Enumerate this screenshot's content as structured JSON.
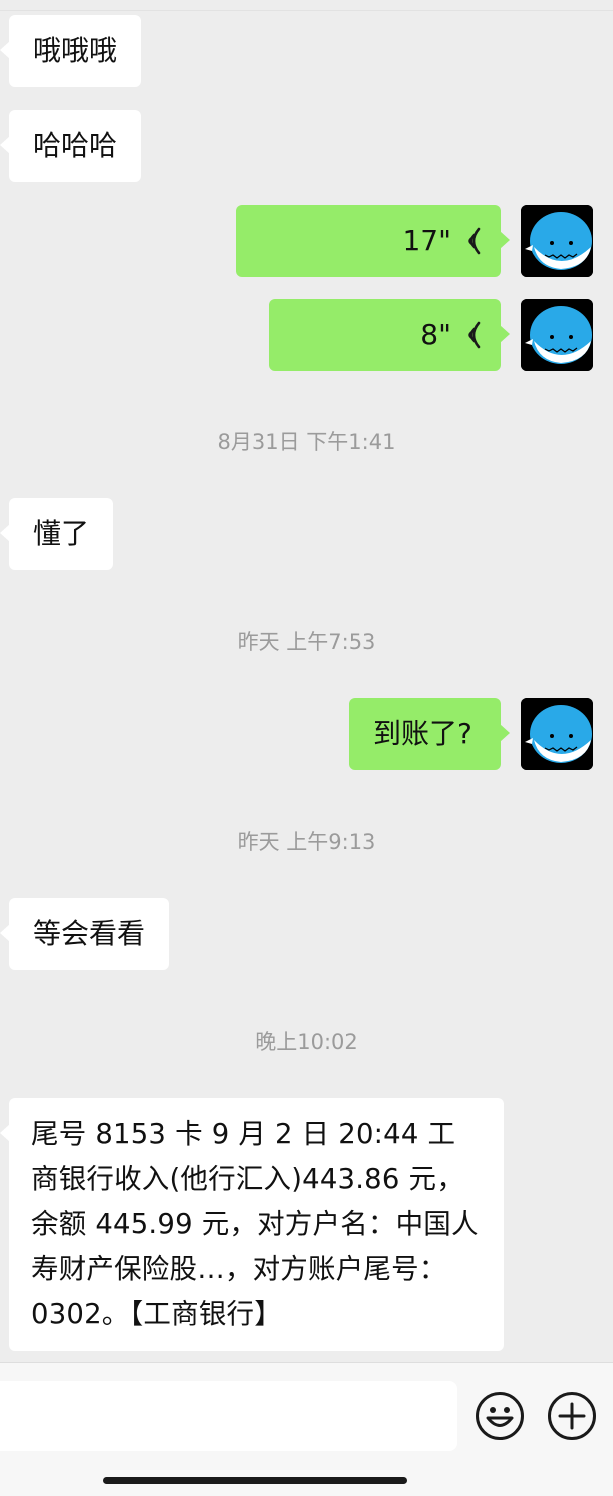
{
  "messages": {
    "m1": "哦哦哦",
    "m2": "哈哈哈",
    "voice1": "17\"",
    "voice2": "8\"",
    "m3": "懂了",
    "m4": "到账了?",
    "m5": "等会看看",
    "m6": "尾号 8153 卡 9 月 2 日 20:44 工商银行收入(他行汇入)443.86 元，余额 445.99 元，对方户名：中国人寿财产保险股…，对方账户尾号：0302。【工商银行】"
  },
  "timestamps": {
    "t1": "8月31日 下午1:41",
    "t2": "昨天 上午7:53",
    "t3": "昨天 上午9:13",
    "t4": "晚上10:02"
  },
  "colors": {
    "background": "#ededed",
    "sent_bubble": "#95ec69",
    "received_bubble": "#ffffff",
    "avatar_whale": "#29a9e8"
  },
  "icons": {
    "voice": "voice-wave-icon",
    "emoji": "emoji-icon",
    "plus": "plus-icon",
    "avatar": "whale-avatar"
  }
}
